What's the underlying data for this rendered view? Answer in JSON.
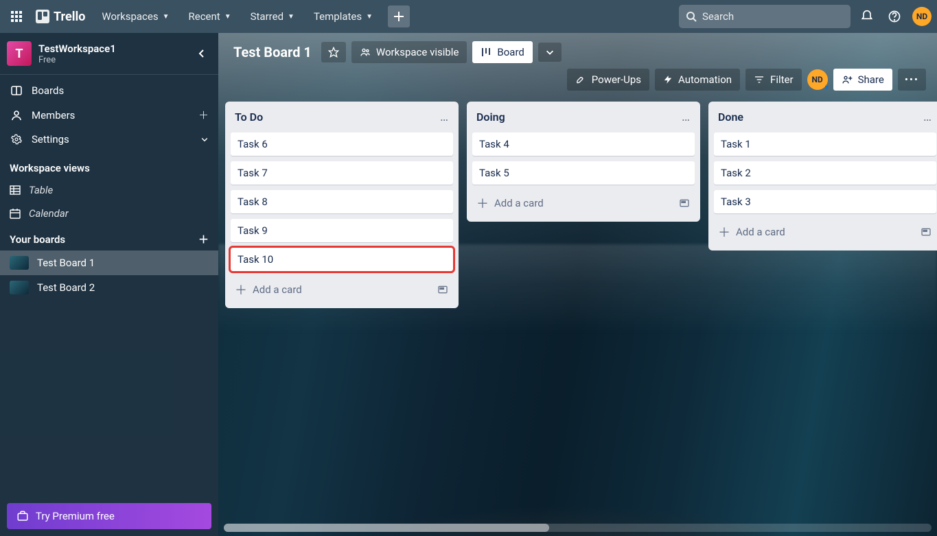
{
  "header": {
    "app_name": "Trello",
    "nav": {
      "workspaces": "Workspaces",
      "recent": "Recent",
      "starred": "Starred",
      "templates": "Templates"
    },
    "search_placeholder": "Search",
    "avatar_initials": "ND"
  },
  "sidebar": {
    "workspace": {
      "tile_letter": "T",
      "name": "TestWorkspace1",
      "plan": "Free"
    },
    "nav": {
      "boards": "Boards",
      "members": "Members",
      "settings": "Settings"
    },
    "views_heading": "Workspace views",
    "views": {
      "table": "Table",
      "calendar": "Calendar"
    },
    "boards_heading": "Your boards",
    "boards": [
      {
        "name": "Test Board 1",
        "active": true
      },
      {
        "name": "Test Board 2",
        "active": false
      }
    ],
    "premium_cta": "Try Premium free"
  },
  "board": {
    "title": "Test Board 1",
    "visibility": "Workspace visible",
    "view_switch": "Board",
    "powerups": "Power-Ups",
    "automation": "Automation",
    "filter": "Filter",
    "share": "Share",
    "member_initials": "ND"
  },
  "lists": [
    {
      "title": "To Do",
      "cards": [
        "Task 6",
        "Task 7",
        "Task 8",
        "Task 9",
        "Task 10"
      ],
      "highlight_index": 4,
      "add_label": "Add a card"
    },
    {
      "title": "Doing",
      "cards": [
        "Task 4",
        "Task 5"
      ],
      "add_label": "Add a card"
    },
    {
      "title": "Done",
      "cards": [
        "Task 1",
        "Task 2",
        "Task 3"
      ],
      "add_label": "Add a card"
    }
  ]
}
